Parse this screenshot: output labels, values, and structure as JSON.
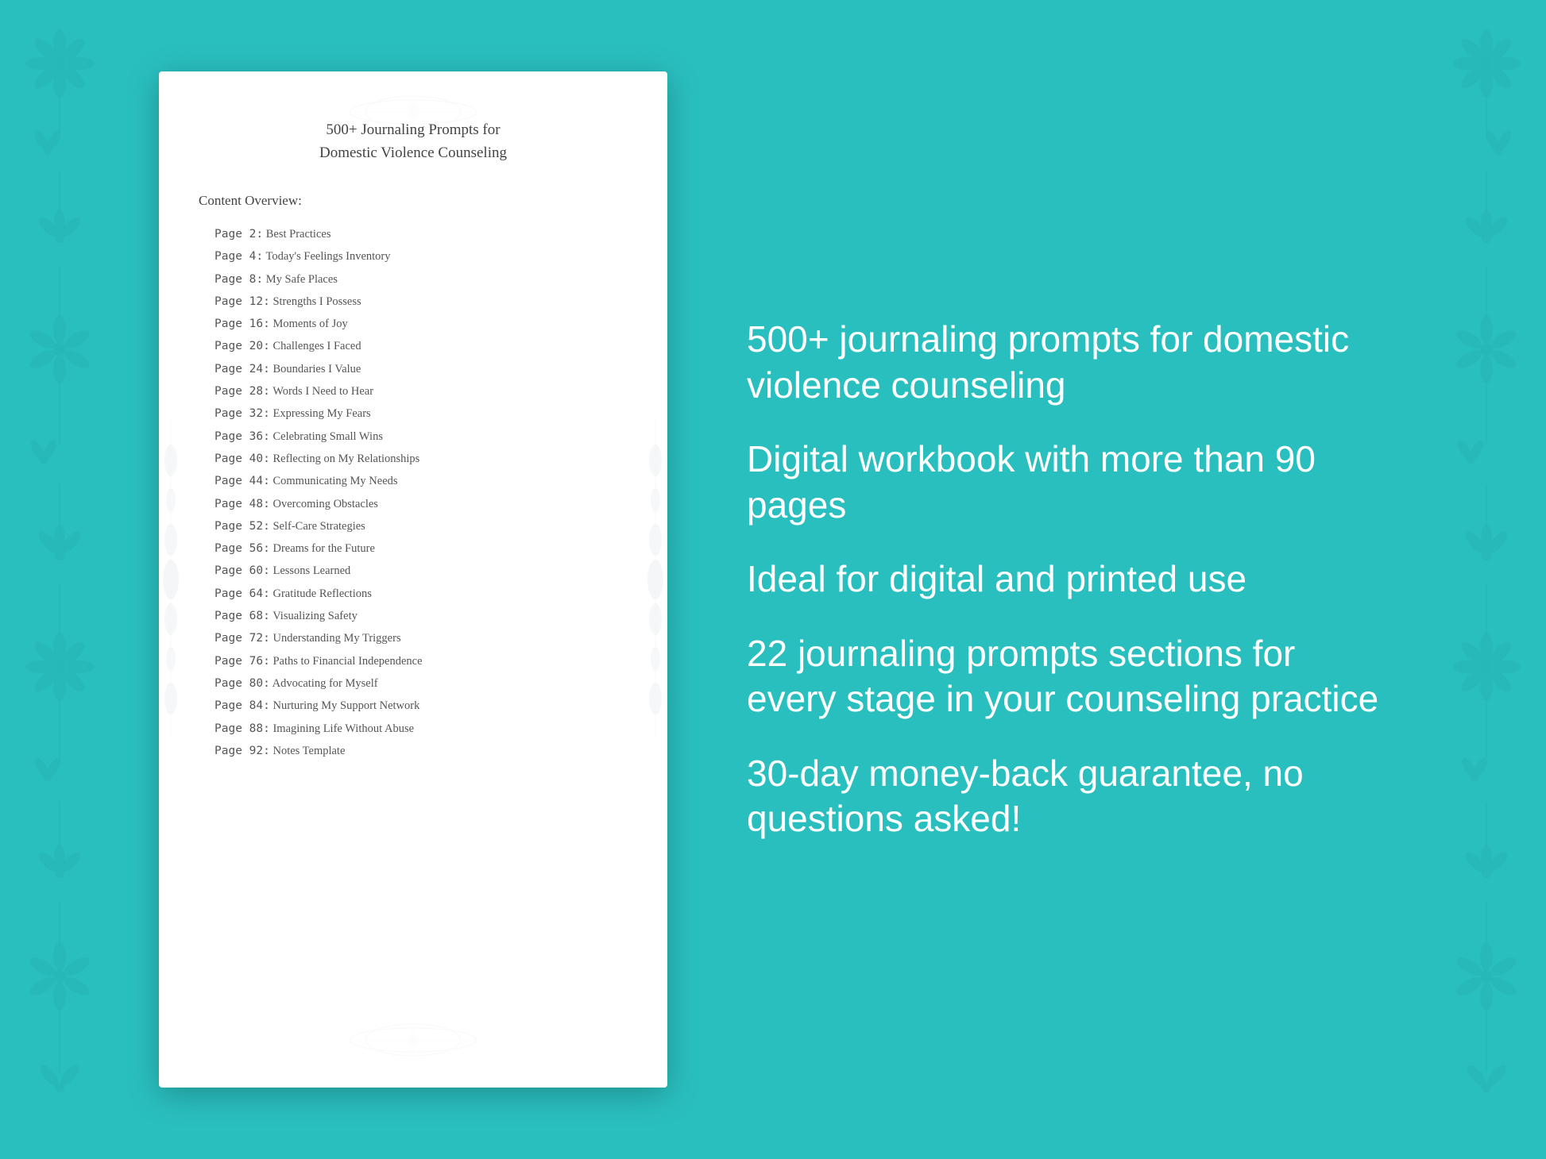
{
  "background_color": "#2abfbf",
  "floral_border": {
    "sprigs": [
      "❧",
      "✿",
      "❧",
      "✿",
      "❧",
      "✿",
      "❧",
      "✿",
      "❧",
      "✿",
      "❧",
      "✿",
      "❧"
    ]
  },
  "book": {
    "title_line1": "500+ Journaling Prompts for",
    "title_line2": "Domestic Violence Counseling",
    "content_overview_heading": "Content Overview:",
    "toc_entries": [
      {
        "page": "Page  2:",
        "title": "Best Practices"
      },
      {
        "page": "Page  4:",
        "title": "Today's Feelings Inventory"
      },
      {
        "page": "Page  8:",
        "title": "My Safe Places"
      },
      {
        "page": "Page 12:",
        "title": "Strengths I Possess"
      },
      {
        "page": "Page 16:",
        "title": "Moments of Joy"
      },
      {
        "page": "Page 20:",
        "title": "Challenges I Faced"
      },
      {
        "page": "Page 24:",
        "title": "Boundaries I Value"
      },
      {
        "page": "Page 28:",
        "title": "Words I Need to Hear"
      },
      {
        "page": "Page 32:",
        "title": "Expressing My Fears"
      },
      {
        "page": "Page 36:",
        "title": "Celebrating Small Wins"
      },
      {
        "page": "Page 40:",
        "title": "Reflecting on My Relationships"
      },
      {
        "page": "Page 44:",
        "title": "Communicating My Needs"
      },
      {
        "page": "Page 48:",
        "title": "Overcoming Obstacles"
      },
      {
        "page": "Page 52:",
        "title": "Self-Care Strategies"
      },
      {
        "page": "Page 56:",
        "title": "Dreams for the Future"
      },
      {
        "page": "Page 60:",
        "title": "Lessons Learned"
      },
      {
        "page": "Page 64:",
        "title": "Gratitude Reflections"
      },
      {
        "page": "Page 68:",
        "title": "Visualizing Safety"
      },
      {
        "page": "Page 72:",
        "title": "Understanding My Triggers"
      },
      {
        "page": "Page 76:",
        "title": "Paths to Financial Independence"
      },
      {
        "page": "Page 80:",
        "title": "Advocating for Myself"
      },
      {
        "page": "Page 84:",
        "title": "Nurturing My Support Network"
      },
      {
        "page": "Page 88:",
        "title": "Imagining Life Without Abuse"
      },
      {
        "page": "Page 92:",
        "title": "Notes Template"
      }
    ]
  },
  "features": [
    "500+ journaling prompts for domestic violence counseling",
    "Digital workbook with more than 90 pages",
    "Ideal for digital and printed use",
    "22 journaling prompts sections for every stage in your counseling practice",
    "30-day money-back guarantee, no questions asked!"
  ]
}
